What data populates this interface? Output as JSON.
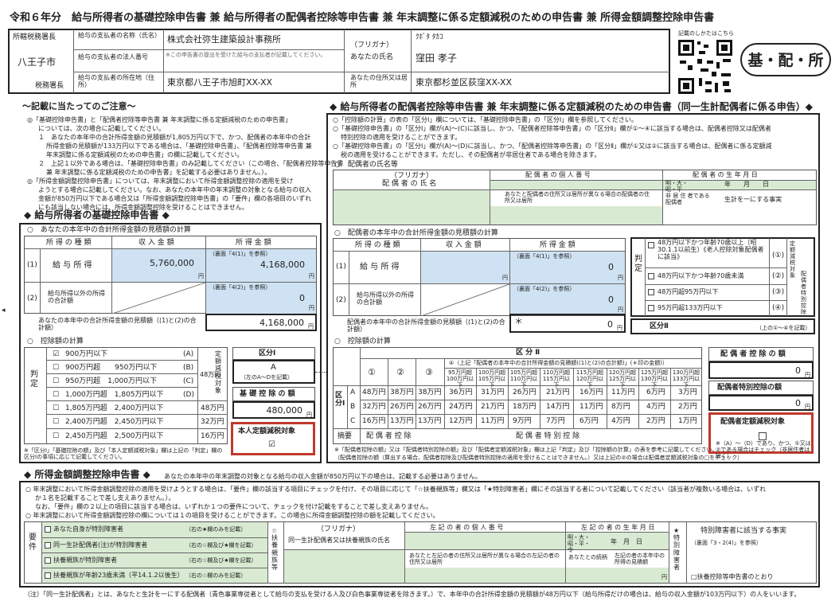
{
  "title": "令和６年分　給与所得者の基礎控除申告書 兼 給与所得者の配偶者控除等申告書 兼 年末調整に係る定額減税のための申告書 兼 所得金額調整控除申告書",
  "header": {
    "tax_office_label": "所轄税務署長",
    "tax_office_name": "八王子市",
    "tax_office_suffix": "税務署長",
    "payer_name_label": "給与の支払者の名称（氏名）",
    "payer_name": "株式会社弥生建築設計事務所",
    "payer_number_label": "給与の支払者の法人番号",
    "payer_number_note": "※この申告書の提出を受けた給与の支払者が記載してください。",
    "payer_address_label": "給与の支払者の所在地（住所）",
    "payer_address": "東京都八王子市旭町XX-XX",
    "furigana_label": "（フリガナ）",
    "my_name_label": "あなたの氏名",
    "furigana_value": "ｸﾎﾞﾀ ﾀｶｺ",
    "my_name": "窪田 孝子",
    "my_address_label": "あなたの住所又は居所",
    "my_address": "東京都杉並区荻窪XX-XX",
    "qr_caption": "記載のしかたはこちら",
    "badge": "基・配・所"
  },
  "notes": {
    "heading": "～記載に当たってのご注意～",
    "lines": [
      "◎「基礎控除申告書」と「配偶者控除等申告書 兼 年末調整に係る定額減税のための申告書」",
      "については、次の場合に記載してください。",
      "１　あなたの本年中の合計所得金額の見積額が1,805万円以下で、かつ、配偶者の本年中の合計",
      "所得金額の見積額が133万円以下である場合は、「基礎控除申告書」、「配偶者控除等申告書 兼",
      "年末調整に係る定額減税のための申告書」の欄に記載してください。",
      "２　上記１以外である場合は、「基礎控除申告書」のみ記載してください（この場合、「配偶者控除等申告書",
      "兼 年末調整に係る定額減税のための申告書」を記載する必要はありません。）。",
      "◎「所得金額調整控除申告書」については、年末調整において所得金額調整控除の適用を受け",
      "ようとする場合に記載してください。なお、あなたの本年中の年末調整の対象となる給与の収入",
      "金額が850万円以下である場合又は「所得金額調整控除申告書」の「要件」欄の各項目のいずれ",
      "にも該当しない場合には、所得金額調整控除を受けることはできません。"
    ]
  },
  "basic": {
    "heading": "◆ 給与所得者の基礎控除申告書 ◆",
    "income_heading": "○　あなたの本年中の合計所得金額の見積額の計算",
    "col_type": "所 得 の 種 類",
    "col_revenue": "収 入 金 額",
    "col_income": "所 得 金 額",
    "row1_no": "(1)",
    "row1_label": "給 与 所 得",
    "row1_revenue": "5,760,000",
    "row1_note": "（裏面「4(1)」を参照）",
    "row1_income": "4,168,000",
    "row2_no": "(2)",
    "row2_label": "給与所得以外の所得の合計額",
    "row2_note": "（裏面「4(2)」を参照）",
    "row2_income": "0",
    "total_label": "あなたの本年中の合計所得金額の見積額（(1)と(2)の合計額）",
    "total_value": "4,168,000",
    "yen": "円",
    "deduction_heading": "○　控除額の計算",
    "judge_label": "判　　　定",
    "rows": [
      {
        "check": "☑",
        "range": "900万円以下",
        "code": "(A)",
        "amount": ""
      },
      {
        "check": "☐",
        "range": "900万円超　　950万円以下",
        "code": "(B)",
        "amount": ""
      },
      {
        "check": "☐",
        "range": "950万円超　1,000万円以下",
        "code": "(C)",
        "amount": ""
      },
      {
        "check": "☐",
        "range": "1,000万円超　1,805万円以下",
        "code": "(D)",
        "amount": ""
      },
      {
        "check": "☐",
        "range": "1,805万円超　2,400万円以下",
        "code": "",
        "amount": "48万円"
      },
      {
        "check": "☐",
        "range": "2,400万円超　2,450万円以下",
        "code": "",
        "amount": "32万円"
      },
      {
        "check": "☐",
        "range": "2,450万円超　2,500万円以下",
        "code": "",
        "amount": "16万円"
      }
    ],
    "amount_48": "48万円",
    "teigaku_vertical": "定額減税対象",
    "kubun1_label": "区分Ⅰ",
    "kubun1_value": "A",
    "kubun1_note": "（左のA～Dを記載）",
    "basic_deduction_label": "基 礎 控 除 の 額",
    "basic_deduction_value": "480,000",
    "self_teigaku_label": "本人定額減税対象",
    "self_teigaku_check": "☑",
    "footnote": "※「区分Ⅰ」「基礎控除の額」及び「本人定額減税対象」欄は上記の「判定」欄の区分Ⅰの事項に応じて記載してください。"
  },
  "spouse": {
    "heading": "◆ 給与所得者の配偶者控除等申告書 兼 年末調整に係る定額減税のための申告書（同一生計配偶者に係る申告）◆",
    "notes": [
      "○「控除額の計算」の表の「区分Ⅰ」欄については、「基礎控除申告書」の「区分Ⅰ」欄を参照してください。",
      "○「基礎控除申告書」の「区分Ⅰ」欄が(A)～(C)に該当し、かつ、「配偶者控除等申告書」の「区分Ⅱ」欄が①～④に該当する場合は、配偶者控除又は配偶者",
      "特別控除の適用を受けることができます。",
      "○「基礎控除申告書」の「区分Ⅰ」欄が(A)～(D)に該当し、かつ、「配偶者控除等申告書」の「区分Ⅱ」欄が①又は②に該当する場合は、配偶者に係る定額減",
      "税の適用を受けることができます。ただし、その配偶者が非居住者である場合を除きます。"
    ],
    "name_heading": "○　配偶者の氏名等",
    "furigana_label": "（フリガナ）",
    "name_label": "配 偶 者 の 氏 名",
    "number_label": "配 偶 者 の 個 人 番 号",
    "birth_label": "配 偶 者 の 生 年 月 日",
    "era_label": "明・大・昭・平",
    "year_month_day": "年　　月　　日",
    "address_label": "あなたと配偶者の住所又は居所が異なる場合の配偶者の住所又は居所",
    "nonresident_label": "非 居 住 者である配偶者",
    "same_living_label": "生計を一にする事実",
    "income_heading": "○　配偶者の本年中の合計所得金額の見積額の計算",
    "col_type": "所 得 の 種 類",
    "col_revenue": "収 入 金 額",
    "col_income": "所 得 金 額",
    "row1_no": "(1)",
    "row1_label": "給 与 所 得",
    "row1_note": "（裏面「4(1)」を参照）",
    "row1_income": "0",
    "row2_no": "(2)",
    "row2_label": "給与所得以外の所得の合計額",
    "row2_note": "（裏面「4(2)」を参照）",
    "row2_income": "0",
    "total_label": "配偶者の本年中の合計所得金額の見積額（(1)と(2)の合計額）",
    "total_star": "＊",
    "total_value": "0",
    "yen": "円",
    "judge_vertical": "判　　定",
    "judge_rows": [
      {
        "label": "48万円以下かつ年齢70歳以上（昭30.1.1以前生）《老人控除対象配偶者に該当》",
        "code": "(①)"
      },
      {
        "label": "48万円以下かつ年齢70歳未満",
        "code": "(②)"
      },
      {
        "label": "48万円超95万円以下",
        "code": "(③)"
      },
      {
        "label": "95万円超133万円以下",
        "code": "(④)"
      }
    ],
    "teigaku_vertical": "定額減税対象",
    "haigusha_tokubetsu_vertical": "配偶者特別控除",
    "kubun2_label": "区分Ⅱ",
    "kubun2_note": "（上の①～④を記載）",
    "deduction_heading": "○　控除額の計算",
    "kubun2_head": "区 分 Ⅱ",
    "kubun4_note": "④（上記「配偶者の本年中の合計所得金額の見積額((1)と(2)の合計額)」(＊印の金額)）",
    "col_nums": [
      "①",
      "②",
      "③"
    ],
    "brackets": [
      "95万円超100万円以下",
      "100万円超105万円以下",
      "105万円超110万円以下",
      "110万円超115万円以下",
      "115万円超120万円以下",
      "120万円超125万円以下",
      "125万円超130万円以下",
      "130万円超133万円以下"
    ],
    "kubun1_vertical": "区分Ⅰ",
    "rows": [
      {
        "code": "A",
        "vals": [
          "48万円",
          "38万円",
          "38万円",
          "36万円",
          "31万円",
          "26万円",
          "21万円",
          "16万円",
          "11万円",
          "6万円",
          "3万円"
        ]
      },
      {
        "code": "B",
        "vals": [
          "32万円",
          "26万円",
          "26万円",
          "24万円",
          "21万円",
          "18万円",
          "14万円",
          "11万円",
          "8万円",
          "4万円",
          "2万円"
        ]
      },
      {
        "code": "C",
        "vals": [
          "16万円",
          "13万円",
          "13万円",
          "12万円",
          "11万円",
          "9万円",
          "7万円",
          "6万円",
          "4万円",
          "2万円",
          "1万円"
        ]
      }
    ],
    "tekiyo": "摘要",
    "haigusha_kojo": "配 偶 者 控 除",
    "haigusha_tokubetsu": "配 偶 者 特 別 控 除",
    "footnote1": "※「配偶者控除の額」又は「配偶者特別控除の額」及び「配偶者定額減税対象」欄は上記「判定」及び「控除額の計算」の表を参考に記載してください。",
    "footnote2": "（配偶者控除の額（算出する場合、配偶者控除及び配偶者特別控除の適用を受けることはできません。）又は上記の②の場合は配偶者定額減税対象の□をチェック）",
    "deduction_label": "配 偶 者 控 除 の 額",
    "deduction_value": "0",
    "special_label": "配偶者特別控除の額",
    "special_value": "0",
    "spouse_teigaku_label": "配偶者定額減税対象",
    "spouse_teigaku_note": "※（A）～（D）であり、かつ、①又は②である場合はチェック（非居住者は除く）"
  },
  "adjust": {
    "heading": "◆ 所得金額調整控除申告書 ◆",
    "heading_note": "あなたの本年中の年末調整の対象となる給与の収入金額が850万円以下の場合は、記載する必要はありません。",
    "lines": [
      "○ 年末調整において所得金額調整控除の適用を受けようとする場合は、「要件」欄の該当する項目にチェックを付け、その項目に応じて「☆扶養親族等」欄又は「★特別障害者」欄にその該当する者について記載してください（該当者が複数いる場合は、いずれ",
      "か１名を記載することで差し支えありません。）。",
      "なお、「要件」欄の２以上の項目に該当する場合は、いずれか１つの要件について、チェックを付け記載をすることで差し支えありません。",
      "○ 年末調整において所得金額調整控除の欄については１の項目を受けることができます。この場合に所得金額調整控除の額を記載してください。"
    ],
    "yoken": "要　件",
    "items": [
      {
        "label": "あなた自身が特別障害者",
        "note": "（右の★欄のみを記載）"
      },
      {
        "label": "同一生計配偶者(注)が特別障害者",
        "note": "（右の☆欄及び★欄を記載）"
      },
      {
        "label": "扶養親族が特別障害者",
        "note": "（右の☆欄及び★欄を記載）"
      },
      {
        "label": "扶養親族が年齢23歳未満（平14.1.2以後生）",
        "note": "（右の☆欄のみを記載）"
      }
    ],
    "star_vertical": "☆扶養親族等",
    "furigana_label": "（フリガナ）",
    "name_label": "同一生計配偶者又は扶養親族の氏名",
    "number_label": "左 記 の 者 の 個 人 番 号",
    "birth_label": "左 記 の 者 の 生 年 月 日",
    "era_label": "明・大・昭・平・令",
    "ymd": "年　月　日",
    "address_label": "あなたと左記の者の住所又は居所が異なる場合の左記の者の住所又は居所",
    "relation_label": "あなたとの続柄",
    "income_label": "左記の者の本年中の所得の見積額",
    "income_yen": "円",
    "tokubetsu_vertical": "★特別障害者",
    "tokubetsu_label": "特別障害者に該当する事実",
    "tokubetsu_ref": "（裏面「3・2(4)」を参照）",
    "tokubetsu_check": "□扶養控除等申告書のとおり",
    "footnote": "（注）「同一生計配偶者」とは、あなたと生計を一にする配偶者（青色事業専従者として給与の支払を受ける人及び白色事業専従者を除きます。）で、本年中の合計所得金額の見積額が48万円以下（給与所得だけの場合は、給与の収入金額が103万円以下）の人をいいます。"
  }
}
